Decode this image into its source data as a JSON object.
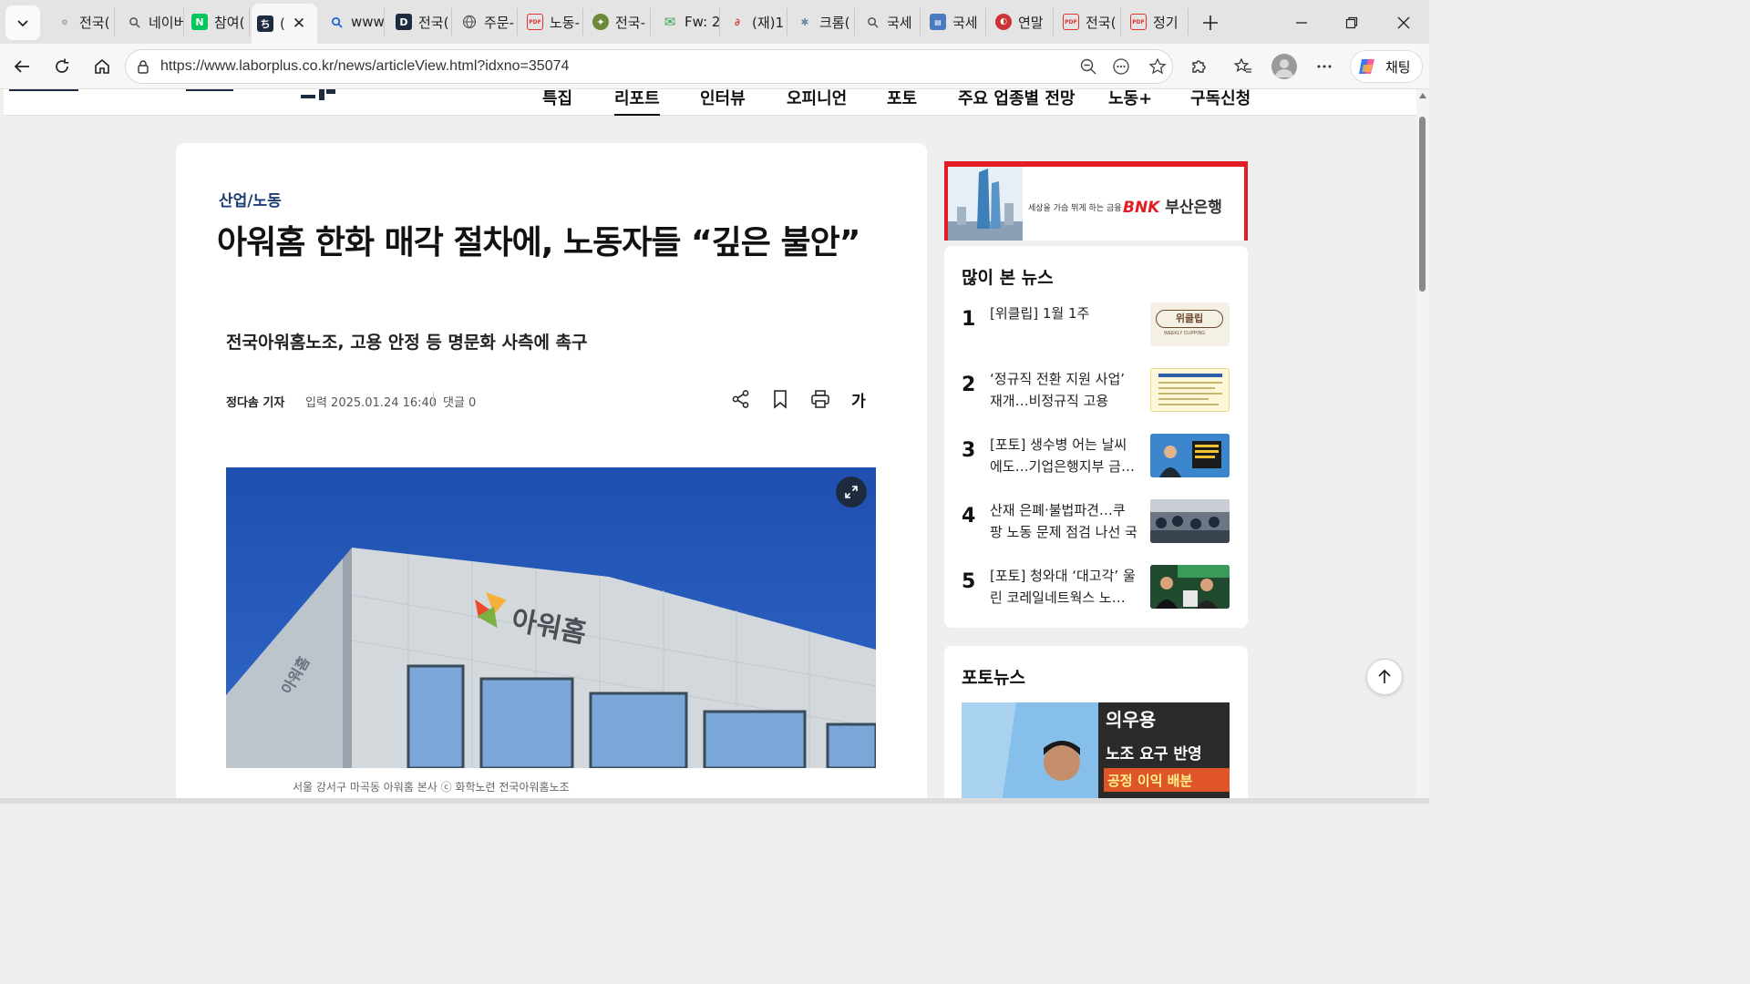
{
  "browser": {
    "tabs": [
      {
        "title": "전국(",
        "icon": "nuo-favicon"
      },
      {
        "title": "네이버",
        "icon": "search-favicon"
      },
      {
        "title": "참여(",
        "icon": "naver-n-favicon"
      },
      {
        "title": "(",
        "icon": "laborplus-favicon",
        "active": true
      },
      {
        "title": "www",
        "icon": "search-favicon"
      },
      {
        "title": "전국(",
        "icon": "d-favicon"
      },
      {
        "title": "주문-",
        "icon": "globe-favicon"
      },
      {
        "title": "노동-",
        "icon": "pdf-favicon"
      },
      {
        "title": "전국-",
        "icon": "emblem-favicon"
      },
      {
        "title": "Fw: 2",
        "icon": "mail-favicon"
      },
      {
        "title": "(재)1",
        "icon": "link-favicon"
      },
      {
        "title": "크롬(",
        "icon": "puzzle-favicon"
      },
      {
        "title": "국세",
        "icon": "search-favicon"
      },
      {
        "title": "국세",
        "icon": "image-favicon"
      },
      {
        "title": "연말",
        "icon": "circle-favicon"
      },
      {
        "title": "전국(",
        "icon": "pdf-favicon"
      },
      {
        "title": "정기",
        "icon": "pdf-favicon"
      }
    ],
    "url": "https://www.laborplus.co.kr/news/articleView.html?idxno=35074",
    "copilot_label": "채팅"
  },
  "site": {
    "nav": [
      "특집",
      "리포트",
      "인터뷰",
      "오피니언",
      "포토",
      "주요 업종별 전망",
      "노동+",
      "구독신청"
    ],
    "active_nav": "리포트"
  },
  "article": {
    "category": "산업/노동",
    "headline": "아워홈 한화 매각 절차에, 노동자들 “깊은 불안”",
    "subheadline": "전국아워홈노조, 고용 안정 등 명문화 사측에 촉구",
    "reporter": "정다솜 기자",
    "published": "입력 2025.01.24 16:40",
    "comments": "댓글 0",
    "fontsize_button": "가",
    "photo_sign": "아워홈",
    "caption": "서울 강서구 마곡동 아워홈 본사 ⓒ 화학노련 전국아워홈노조"
  },
  "ad": {
    "slogan": "세상을 가슴 뛰게 하는 금융",
    "brand_en": "BNK",
    "brand_ko": "부산은행",
    "accent": "#e21d25"
  },
  "most_viewed": {
    "title": "많이 본 뉴스",
    "items": [
      {
        "rank": "1",
        "text": "[위클립] 1월 1주",
        "thumb_text": "위클립",
        "thumb_sub": "WEEKLY CLIPPING"
      },
      {
        "rank": "2",
        "text": "‘정규직 전환 지원 사업’ 재개…비정규직 고용 안…"
      },
      {
        "rank": "3",
        "text": "[포토] 생수병 어는 날씨에도…기업은행지부 금…"
      },
      {
        "rank": "4",
        "text": "산재 은폐·불법파견…쿠팡 노동 문제 점검 나선 국회"
      },
      {
        "rank": "5",
        "text": "[포토] 청와대 ‘대고각’ 울린 코레일네트웍스 노…"
      }
    ]
  },
  "photo_news": {
    "title": "포토뉴스",
    "sign_text_1": "의우용",
    "sign_text_2": "노조 요구 반영",
    "sign_text_3": "공정 이익 배분"
  },
  "colors": {
    "category": "#1c3f75",
    "sky": "#2556b6"
  }
}
